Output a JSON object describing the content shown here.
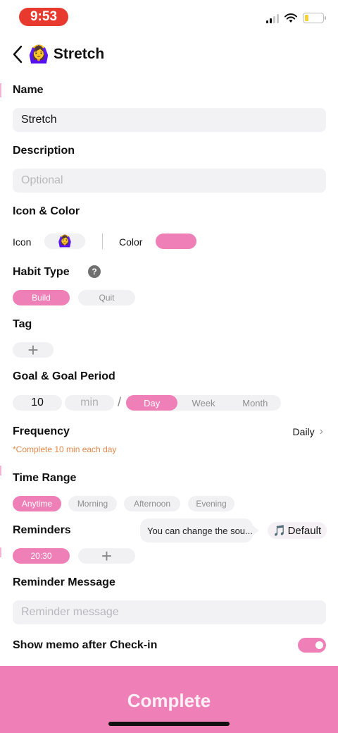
{
  "status_bar": {
    "time": "9:53"
  },
  "header": {
    "title": "Stretch",
    "emoji": "🙆‍♀️"
  },
  "form": {
    "name": {
      "label": "Name",
      "value": "Stretch"
    },
    "description": {
      "label": "Description",
      "placeholder": "Optional"
    },
    "icon_color": {
      "label": "Icon & Color",
      "icon_label": "Icon",
      "icon_value": "🙆‍♀️",
      "color_label": "Color",
      "color_value": "#ef7fb7"
    },
    "habit_type": {
      "label": "Habit Type",
      "help": "?",
      "options": [
        "Build",
        "Quit"
      ],
      "selected": "Build"
    },
    "tag": {
      "label": "Tag",
      "add": "+"
    },
    "goal": {
      "label": "Goal & Goal Period",
      "amount": "10",
      "unit": "min",
      "separator": "/",
      "periods": [
        "Day",
        "Week",
        "Month"
      ],
      "selected": "Day"
    },
    "frequency": {
      "label": "Frequency",
      "value": "Daily",
      "chevron": "›",
      "note": "*Complete 10 min each day"
    },
    "time_range": {
      "label": "Time Range",
      "options": [
        "Anytime",
        "Morning",
        "Afternoon",
        "Evening"
      ],
      "selected": "Anytime"
    },
    "reminders": {
      "label": "Reminders",
      "tooltip": "You can change the sou...",
      "sound_icon": "🎵",
      "sound": "Default",
      "time": "20:30",
      "add": "+"
    },
    "reminder_message": {
      "label": "Reminder Message",
      "placeholder": "Reminder message"
    },
    "memo": {
      "label": "Show memo after Check-in",
      "enabled": true
    }
  },
  "footer": {
    "complete_label": "Complete"
  },
  "colors": {
    "accent": "#ef7fb7",
    "field_bg": "#f2f2f4",
    "note": "#e0894a",
    "time_pill": "#e8392f"
  }
}
